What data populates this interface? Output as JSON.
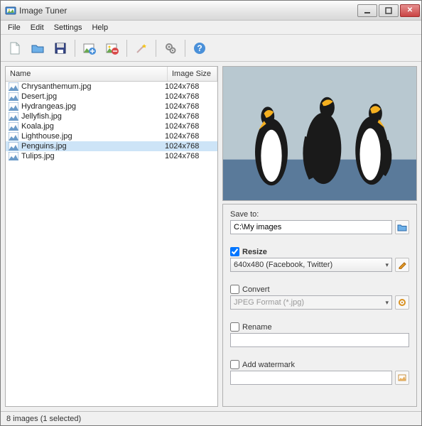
{
  "window": {
    "title": "Image Tuner"
  },
  "menu": {
    "file": "File",
    "edit": "Edit",
    "settings": "Settings",
    "help": "Help"
  },
  "list": {
    "col_name": "Name",
    "col_size": "Image Size",
    "rows": [
      {
        "name": "Chrysanthemum.jpg",
        "size": "1024x768"
      },
      {
        "name": "Desert.jpg",
        "size": "1024x768"
      },
      {
        "name": "Hydrangeas.jpg",
        "size": "1024x768"
      },
      {
        "name": "Jellyfish.jpg",
        "size": "1024x768"
      },
      {
        "name": "Koala.jpg",
        "size": "1024x768"
      },
      {
        "name": "Lighthouse.jpg",
        "size": "1024x768"
      },
      {
        "name": "Penguins.jpg",
        "size": "1024x768"
      },
      {
        "name": "Tulips.jpg",
        "size": "1024x768"
      }
    ],
    "selected_index": 6
  },
  "options": {
    "save_to_label": "Save to:",
    "save_to_value": "C:\\My images",
    "resize_label": "Resize",
    "resize_checked": true,
    "resize_value": "640x480 (Facebook, Twitter)",
    "convert_label": "Convert",
    "convert_checked": false,
    "convert_value": "JPEG Format (*.jpg)",
    "rename_label": "Rename",
    "rename_checked": false,
    "rename_value": "",
    "watermark_label": "Add watermark",
    "watermark_checked": false,
    "watermark_value": ""
  },
  "status": {
    "text": "8 images (1 selected)"
  }
}
